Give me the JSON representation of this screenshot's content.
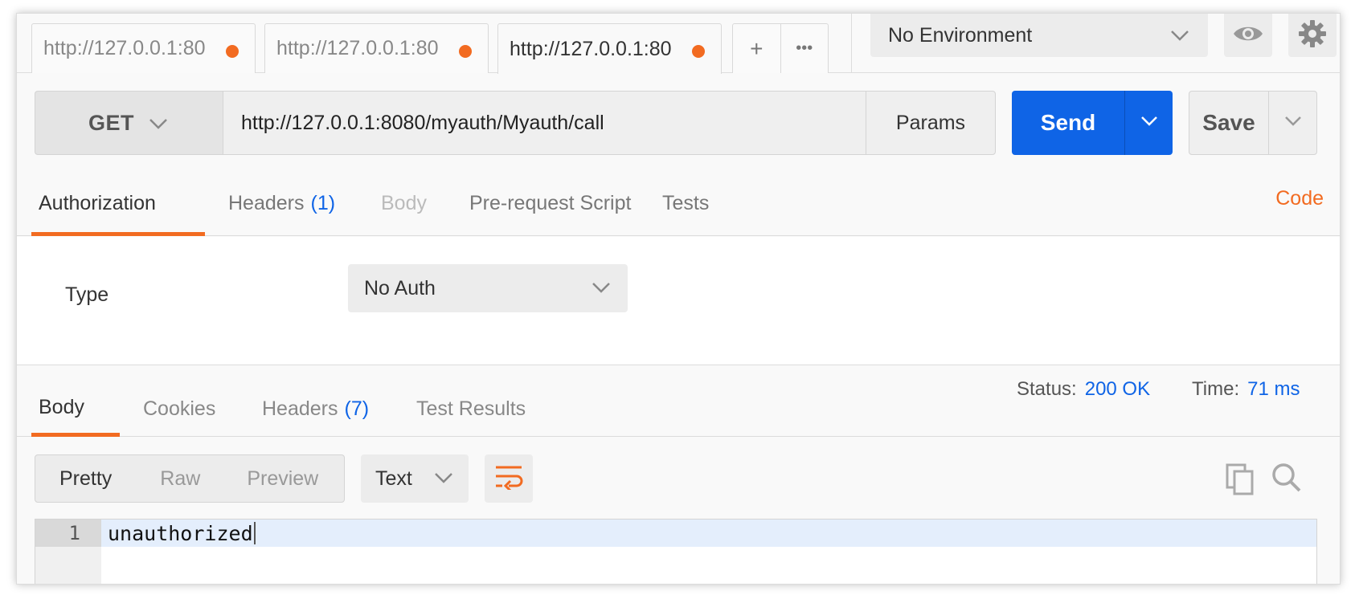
{
  "tabs": [
    {
      "label": "http://127.0.0.1:80",
      "active": false
    },
    {
      "label": "http://127.0.0.1:80",
      "active": false
    },
    {
      "label": "http://127.0.0.1:80",
      "active": true
    }
  ],
  "tab_actions": {
    "new_tab": "+",
    "more": "•••"
  },
  "environment": {
    "selected": "No Environment"
  },
  "request": {
    "method": "GET",
    "url": "http://127.0.0.1:8080/myauth/Myauth/call",
    "params_label": "Params",
    "send_label": "Send",
    "save_label": "Save"
  },
  "request_tabs": {
    "authorization": "Authorization",
    "headers": "Headers",
    "headers_count": "(1)",
    "body": "Body",
    "prerequest": "Pre-request Script",
    "tests": "Tests",
    "code": "Code"
  },
  "auth": {
    "type_label": "Type",
    "selected": "No Auth"
  },
  "response_tabs": {
    "body": "Body",
    "cookies": "Cookies",
    "headers": "Headers",
    "headers_count": "(7)",
    "test_results": "Test Results"
  },
  "response_status": {
    "status_label": "Status:",
    "status_value": "200 OK",
    "time_label": "Time:",
    "time_value": "71 ms"
  },
  "view_modes": {
    "pretty": "Pretty",
    "raw": "Raw",
    "preview": "Preview"
  },
  "format": {
    "selected": "Text"
  },
  "editor": {
    "line_number": "1",
    "content": "unauthorized"
  },
  "colors": {
    "accent": "#f26b21",
    "primary": "#0f64e6"
  },
  "icons": [
    "chevron-down-icon",
    "eye-icon",
    "gear-icon",
    "wrap-lines-icon",
    "copy-icon",
    "search-icon"
  ]
}
